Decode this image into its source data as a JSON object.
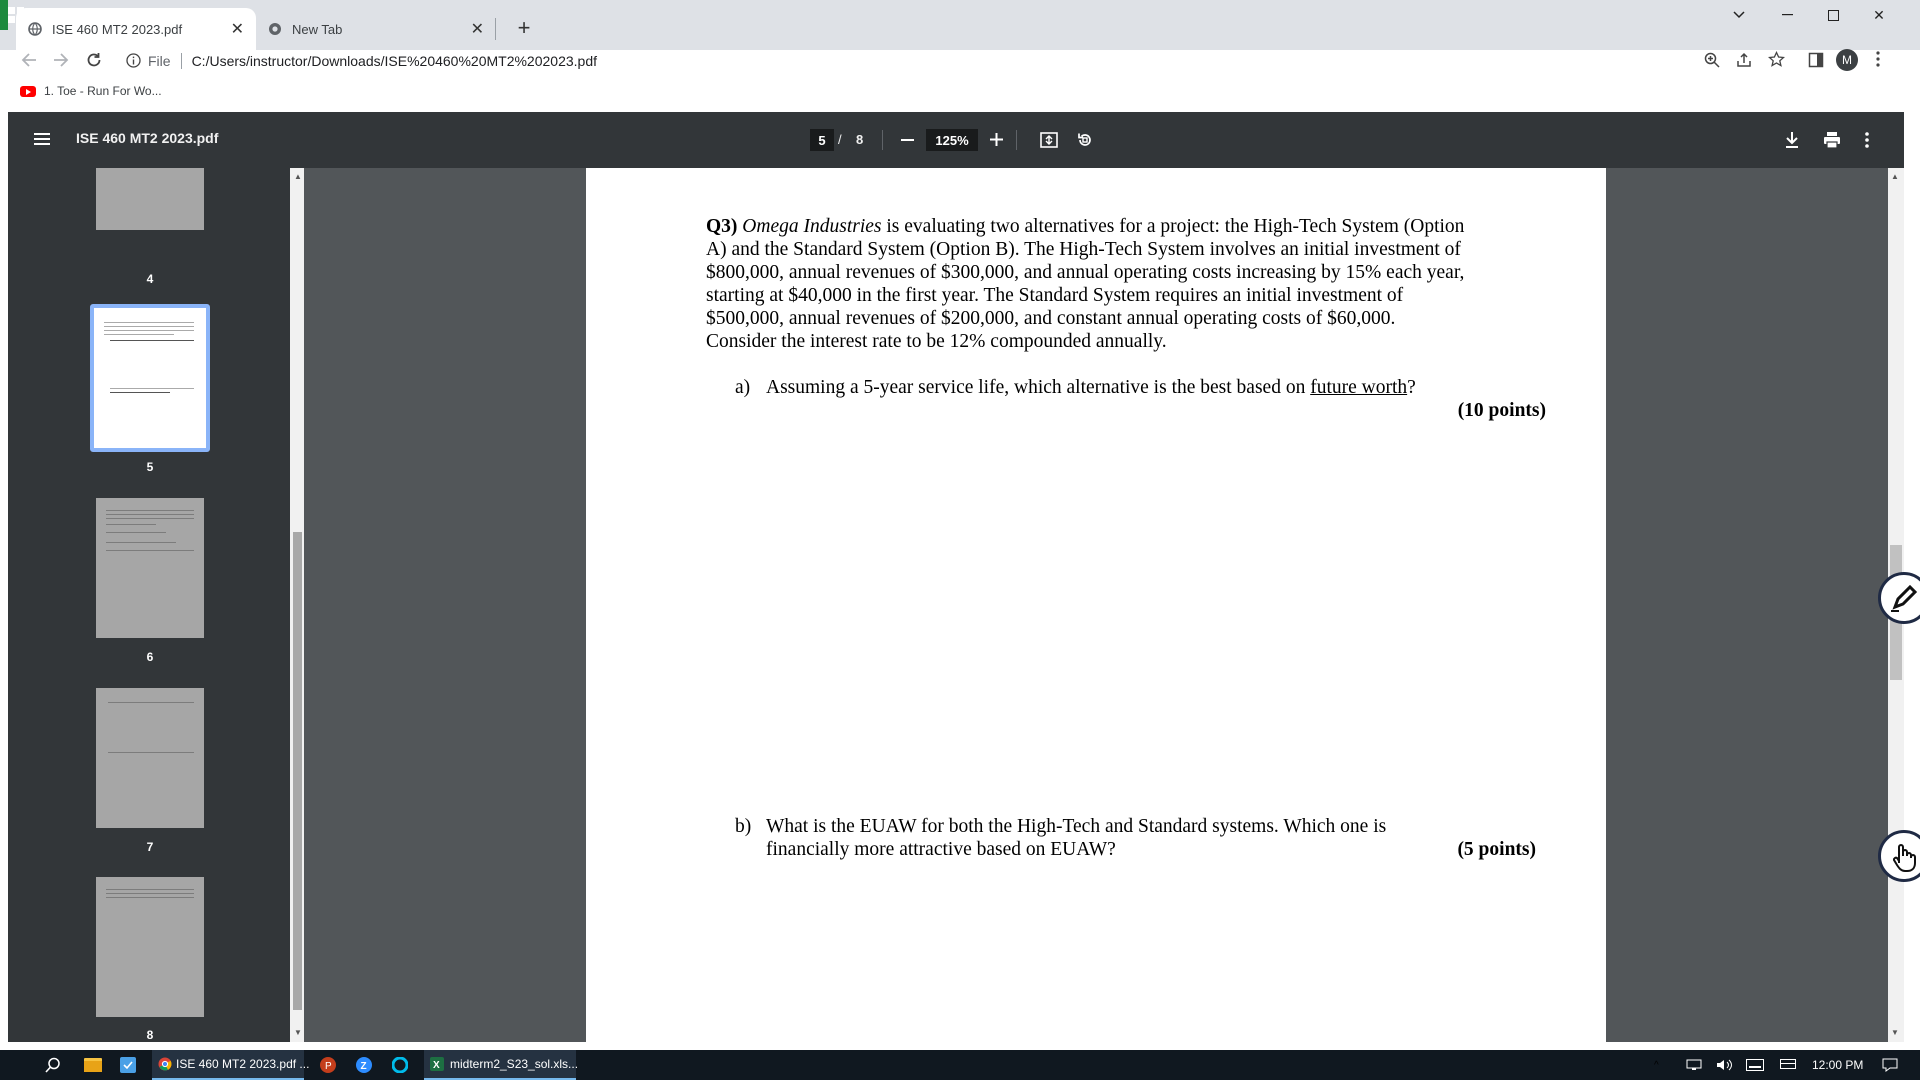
{
  "browser": {
    "tabs": [
      {
        "title": "ISE 460 MT2 2023.pdf",
        "active": true
      },
      {
        "title": "New Tab",
        "active": false
      }
    ],
    "url_scheme": "File",
    "url": "C:/Users/instructor/Downloads/ISE%20460%20MT2%202023.pdf",
    "bookmark": "1. Toe - Run For Wo...",
    "profile_initial": "M"
  },
  "pdf": {
    "title": "ISE 460 MT2 2023.pdf",
    "current_page": "5",
    "page_sep": "/",
    "total_pages": "8",
    "zoom": "125%",
    "thumbnails": [
      {
        "label": "4",
        "selected": false
      },
      {
        "label": "5",
        "selected": true
      },
      {
        "label": "6",
        "selected": false
      },
      {
        "label": "7",
        "selected": false
      },
      {
        "label": "8",
        "selected": false
      }
    ]
  },
  "document": {
    "q3_label": "Q3)",
    "q3_company": "Omega Industries",
    "q3_line1_rest": " is evaluating two alternatives for a project: the High-Tech System (Option",
    "q3_line2": "A) and the Standard System (Option B). The High-Tech System involves an initial investment of",
    "q3_line3": "$800,000, annual revenues of $300,000, and annual operating costs increasing by 15% each year,",
    "q3_line4": "starting at $40,000 in the first year. The Standard System requires an initial investment of",
    "q3_line5": "$500,000, annual revenues of $200,000, and constant annual operating costs of $60,000.",
    "q3_line6": "Consider the interest rate to be 12% compounded annually.",
    "a_label": "a)",
    "a_text_pre": "Assuming a 5-year service life, which alternative is the best based on ",
    "a_text_underlined": "future worth",
    "a_text_post": "?",
    "a_points": "(10 points)",
    "b_label": "b)",
    "b_line1": "What is the EUAW for both the High-Tech and Standard systems. Which one is",
    "b_line2": "financially more attractive based on EUAW?",
    "b_points": "(5 points)"
  },
  "taskbar": {
    "apps": [
      {
        "label": "ISE 460 MT2 2023.pdf ..."
      },
      {
        "label": "midterm2_S23_sol.xls..."
      }
    ],
    "time": "12:00 PM"
  }
}
